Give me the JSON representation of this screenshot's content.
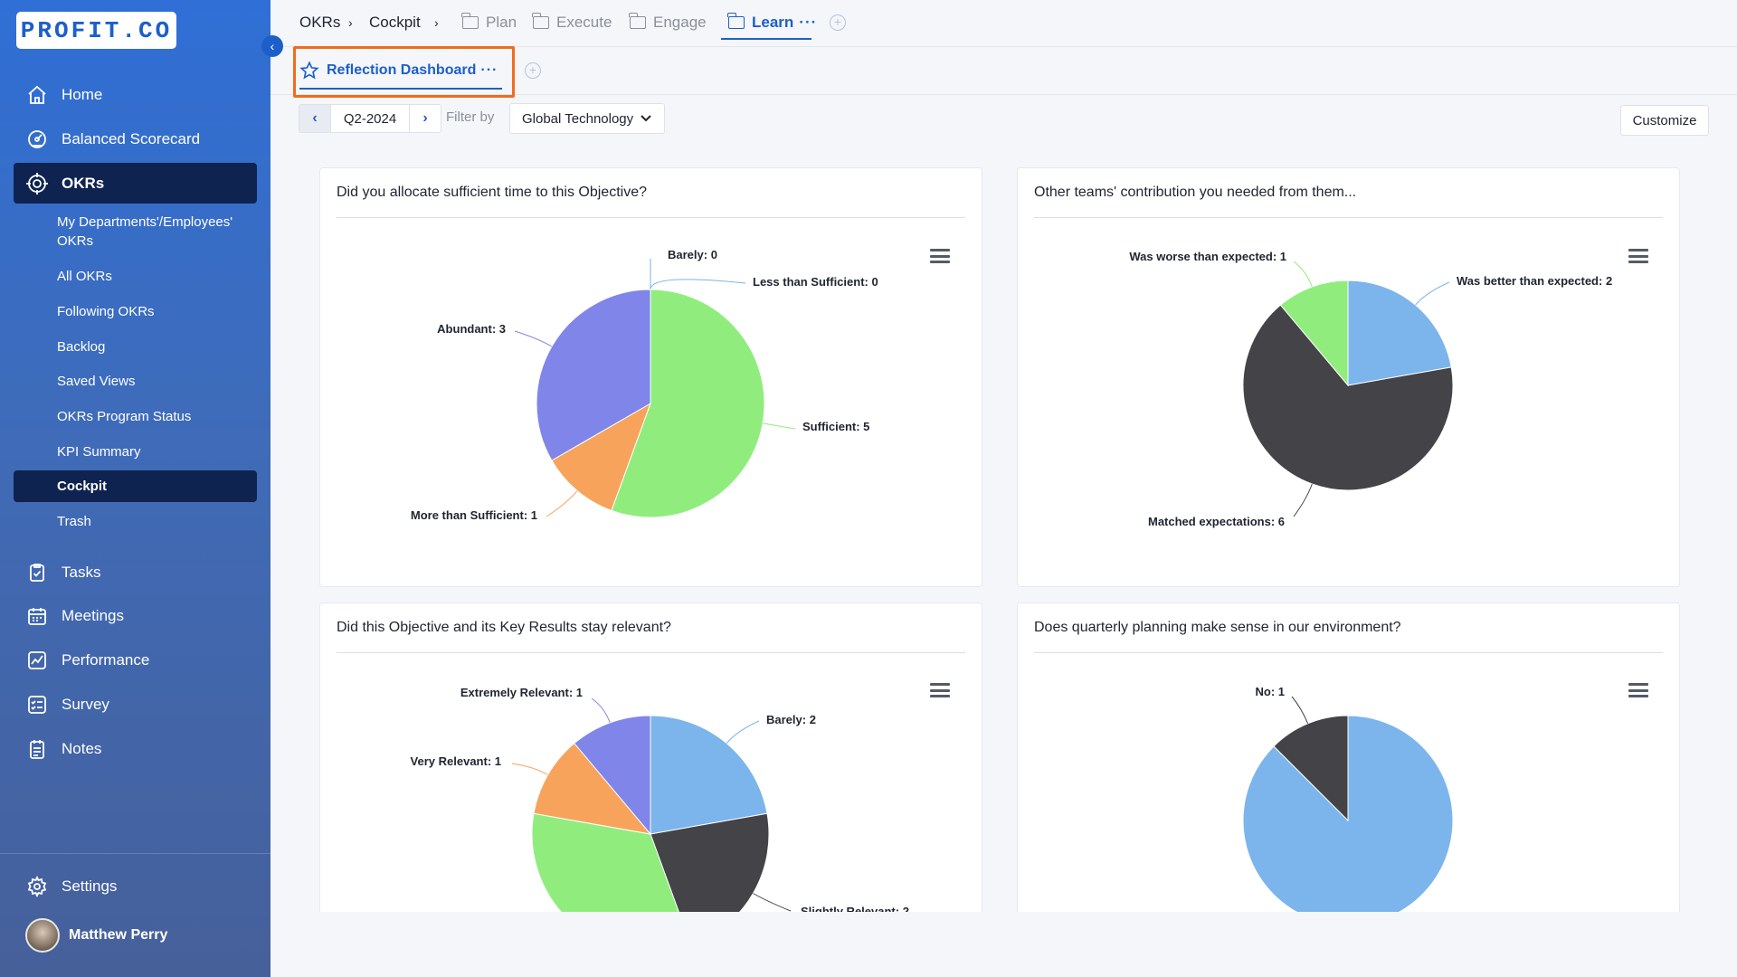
{
  "brand": {
    "logo_text": "PROFIT.CO",
    "accent": "#1d5fc9",
    "highlight": "#f26b1d"
  },
  "sidebar": {
    "items": [
      {
        "label": "Home",
        "icon": "home-icon"
      },
      {
        "label": "Balanced Scorecard",
        "icon": "scorecard-icon"
      },
      {
        "label": "OKRs",
        "icon": "target-icon",
        "active": true
      }
    ],
    "okr_subitems": [
      {
        "label": "My Departments'/Employees'"
      },
      {
        "label": "OKRs"
      },
      {
        "label": "All OKRs"
      },
      {
        "label": "Following OKRs"
      },
      {
        "label": "Backlog"
      },
      {
        "label": "Saved Views"
      },
      {
        "label": "OKRs Program Status"
      },
      {
        "label": "KPI Summary"
      },
      {
        "label": "Cockpit",
        "active": true
      },
      {
        "label": "Trash"
      }
    ],
    "lower_items": [
      {
        "label": "Tasks",
        "icon": "tasks-icon"
      },
      {
        "label": "Meetings",
        "icon": "calendar-icon"
      },
      {
        "label": "Performance",
        "icon": "chart-line-icon"
      },
      {
        "label": "Survey",
        "icon": "survey-icon"
      },
      {
        "label": "Notes",
        "icon": "notes-icon"
      }
    ],
    "settings_label": "Settings",
    "user_name": "Matthew Perry"
  },
  "breadcrumb": {
    "okrs": "OKRs",
    "cockpit": "Cockpit",
    "sep": "›",
    "folders": [
      {
        "label": "Plan"
      },
      {
        "label": "Execute"
      },
      {
        "label": "Engage"
      },
      {
        "label": "Learn",
        "active": true
      }
    ],
    "more": "···"
  },
  "dashboard_tab": {
    "label": "Reflection Dashboard",
    "more": "···"
  },
  "filters": {
    "period": "Q2-2024",
    "filter_label": "Filter by",
    "filter_value": "Global Technology",
    "customize_label": "Customize"
  },
  "chart_data": [
    {
      "type": "pie",
      "title": "Did you allocate sufficient time to this Objective?",
      "slices": [
        {
          "label": "Barely: 0",
          "value": 0,
          "color": "#7cb5ec"
        },
        {
          "label": "Less than Sufficient: 0",
          "value": 0,
          "color": "#434348"
        },
        {
          "label": "Sufficient: 5",
          "value": 5,
          "color": "#90ed7d"
        },
        {
          "label": "More than Sufficient: 1",
          "value": 1,
          "color": "#f7a35c"
        },
        {
          "label": "Abundant: 3",
          "value": 3,
          "color": "#8085e9"
        }
      ]
    },
    {
      "type": "pie",
      "title": "Other teams' contribution you needed from them...",
      "slices": [
        {
          "label": "Was better than expected: 2",
          "value": 2,
          "color": "#7cb5ec"
        },
        {
          "label": "Matched expectations: 6",
          "value": 6,
          "color": "#434348"
        },
        {
          "label": "Was worse than expected: 1",
          "value": 1,
          "color": "#90ed7d"
        }
      ]
    },
    {
      "type": "pie",
      "title": "Did this Objective and its Key Results stay relevant?",
      "slices": [
        {
          "label": "Barely: 2",
          "value": 2,
          "color": "#7cb5ec"
        },
        {
          "label": "Slightly Relevant: 2",
          "value": 2,
          "color": "#434348"
        },
        {
          "label": "",
          "value": 3,
          "color": "#90ed7d"
        },
        {
          "label": "Very Relevant: 1",
          "value": 1,
          "color": "#f7a35c"
        },
        {
          "label": "Extremely Relevant: 1",
          "value": 1,
          "color": "#8085e9"
        }
      ]
    },
    {
      "type": "pie",
      "title": "Does quarterly planning make sense in our environment?",
      "slices": [
        {
          "label": "",
          "value": 7,
          "color": "#7cb5ec"
        },
        {
          "label": "No: 1",
          "value": 1,
          "color": "#434348"
        }
      ]
    }
  ]
}
